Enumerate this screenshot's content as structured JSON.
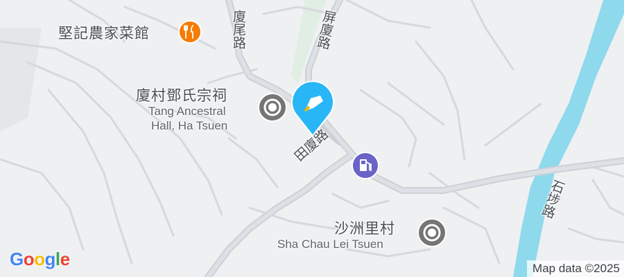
{
  "map": {
    "pois": {
      "restaurant": {
        "name": "堅記農家菜館",
        "icon": "restaurant-icon",
        "color": "#f57c00"
      },
      "ancestral_hall": {
        "name_zh": "廈村鄧氏宗祠",
        "name_en_line1": "Tang Ancestral",
        "name_en_line2": "Hall, Ha Tsuen",
        "icon": "landmark-icon",
        "color": "#757575"
      },
      "village": {
        "name_zh": "沙洲里村",
        "name_en": "Sha Chau Lei Tsuen",
        "icon": "landmark-icon",
        "color": "#757575"
      },
      "gas_station": {
        "icon": "gas-station-icon",
        "color": "#6b62c8"
      }
    },
    "roads": {
      "ha_mei_road": "廈尾路",
      "ping_ha_road": "屏廈路",
      "tin_ha_road": "田廈路",
      "shek_po_road": "石埗路"
    },
    "pin": {
      "icon": "location-pin-icon",
      "color": "#29b6f6"
    },
    "water_color": "#8fd9ec",
    "attribution": "Map data ©2025",
    "logo": {
      "g1": "G",
      "g2": "o",
      "g3": "o",
      "g4": "g",
      "g5": "l",
      "g6": "e"
    }
  }
}
